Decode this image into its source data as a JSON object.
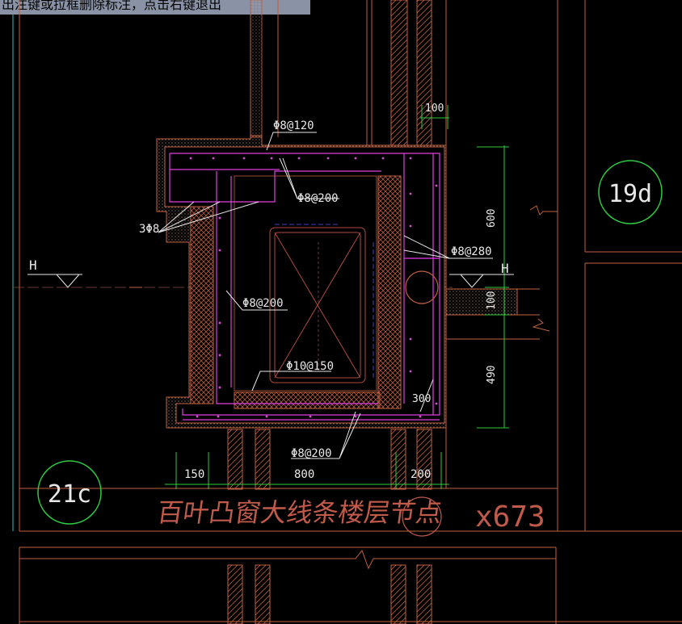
{
  "status_hint": "出注键或拉框删除标注，点击右键退出",
  "colors": {
    "background": "#000000",
    "wall": "#c06040",
    "rebar": "#e040e0",
    "dimension": "#e8e8e8",
    "axis_line": "#2ec0c0",
    "grid_bubble": "#2ecc40",
    "title": "#c05a4a",
    "object": "#8a6a66"
  },
  "rebar_labels": [
    "Φ8@120",
    "Φ8@200",
    "3Φ8",
    "Φ8@280",
    "Φ8@200",
    "Φ10@150",
    "Φ8@200"
  ],
  "dimensions": [
    "100",
    "600",
    "100",
    "490",
    "300",
    "150",
    "800",
    "200"
  ],
  "level_marks": [
    "H",
    "H"
  ],
  "grid_bubbles": [
    "19d",
    "21c"
  ],
  "title": "百叶凸窗大线条楼层节点",
  "detail_ref": "x673"
}
